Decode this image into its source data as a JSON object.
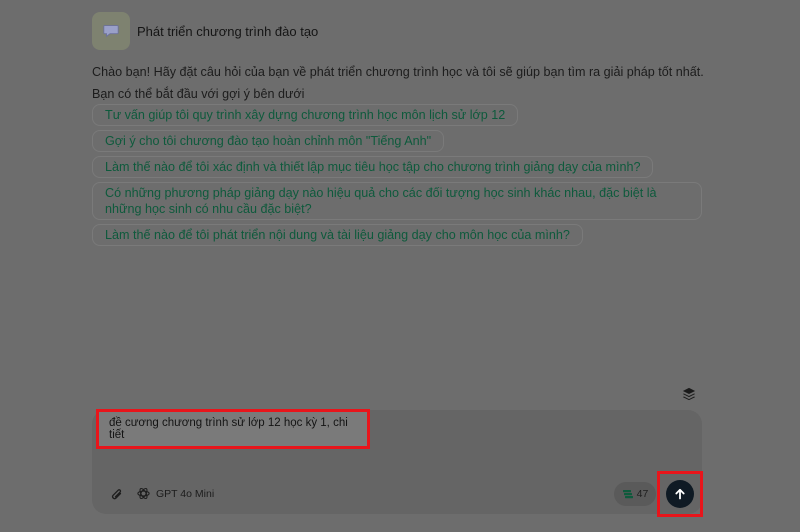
{
  "bot": {
    "title": "Phát triển chương trình đào tạo",
    "avatar_icon": "speech-bubble-icon"
  },
  "greeting": {
    "line1": "Chào bạn! Hãy đặt câu hỏi của bạn về phát triển chương trình học và tôi sẽ giúp bạn tìm ra giải pháp tốt nhất.",
    "line2": "Bạn có thể bắt đầu với gợi ý bên dưới"
  },
  "suggestions": [
    "Tư vấn giúp tôi quy trình xây dựng chương trình học môn lịch sử lớp 12",
    "Gợi ý cho tôi chương đào tạo hoàn chỉnh môn \"Tiếng Anh\"",
    "Làm thế nào để tôi xác định và thiết lập mục tiêu học tập cho chương trình giảng dạy của mình?",
    "Có những phương pháp giảng dạy nào hiệu quả cho các đối tượng học sinh khác nhau, đặc biệt là những học sinh có nhu cầu đặc biệt?",
    "Làm thế nào để tôi phát triển nội dung và tài liệu giảng dạy cho môn học của mình?"
  ],
  "composer": {
    "input_value": "đề cương chương trình sử lớp 12 học kỳ 1, chi tiết",
    "model": "GPT 4o Mini",
    "credits": "47",
    "icons": {
      "attach": "paperclip-icon",
      "model": "openai-logo-icon",
      "credits": "coins-icon",
      "send": "arrow-up-icon",
      "layers": "layers-icon"
    }
  },
  "colors": {
    "highlight": "#e8151b",
    "suggestion_text": "#0e5a3c",
    "send_button": "#0f1a24"
  }
}
